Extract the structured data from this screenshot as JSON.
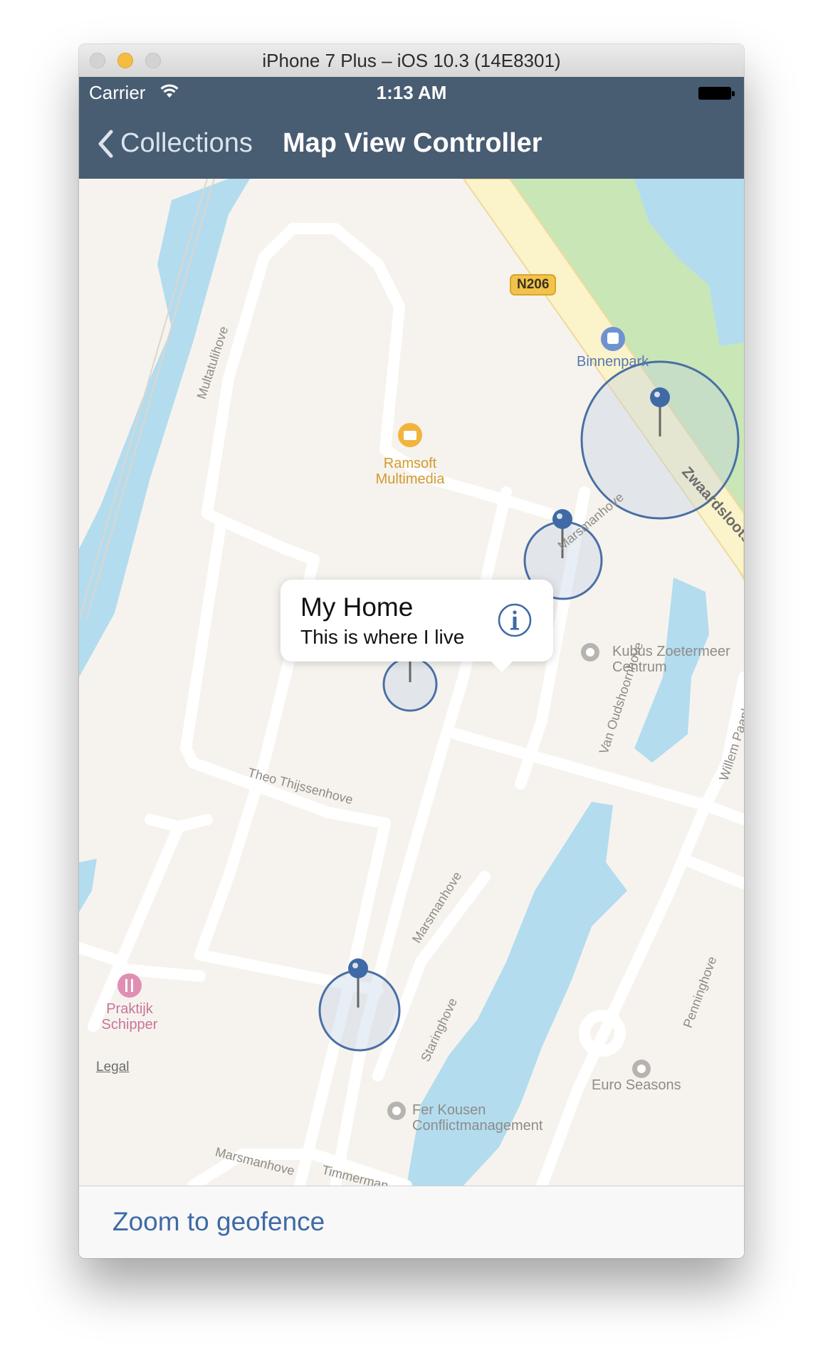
{
  "window": {
    "title": "iPhone 7 Plus – iOS 10.3 (14E8301)"
  },
  "status_bar": {
    "carrier": "Carrier",
    "time": "1:13 AM"
  },
  "nav_bar": {
    "back_label": "Collections",
    "title": "Map View Controller"
  },
  "map": {
    "road_shield": "N206",
    "labels": {
      "binnenpark": "Binnenpark",
      "ramsoft_line1": "Ramsoft",
      "ramsoft_line2": "Multimedia",
      "kubus_line1": "Kubus Zoetermeer",
      "kubus_line2": "Centrum",
      "euro_seasons": "Euro Seasons",
      "ferkousen_line1": "Fer Kousen",
      "ferkousen_line2": "Conflictmanagement",
      "praktijk_line1": "Praktijk",
      "praktijk_line2": "Schipper",
      "multatulihove": "Multatulihove",
      "theo": "Theo Thijssenhove",
      "marsmanhove": "Marsmanhove",
      "marsmanhove2": "Marsmanhove",
      "marsmanhove3": "Marsmanhove",
      "staringhove": "Staringhove",
      "van_oudshoornhove": "Van Oudshoornhove",
      "penninghove": "Penninghove",
      "willem": "Willem Paaphove",
      "zwaardslootse": "Zwaardslootse",
      "timmerman": "Timmerman"
    },
    "legal": "Legal",
    "callout": {
      "title": "My Home",
      "subtitle": "This is where I live"
    },
    "icons": [
      "bus-icon",
      "briefcase-icon",
      "poi-dot-icon",
      "restaurant-icon",
      "pin-icon",
      "info-icon"
    ],
    "colors": {
      "water": "#b3dcef",
      "park": "#c9e6b6",
      "geofence": "#4a6fa5",
      "road_major": "#fbf3c9"
    }
  },
  "toolbar": {
    "zoom_label": "Zoom to geofence"
  }
}
